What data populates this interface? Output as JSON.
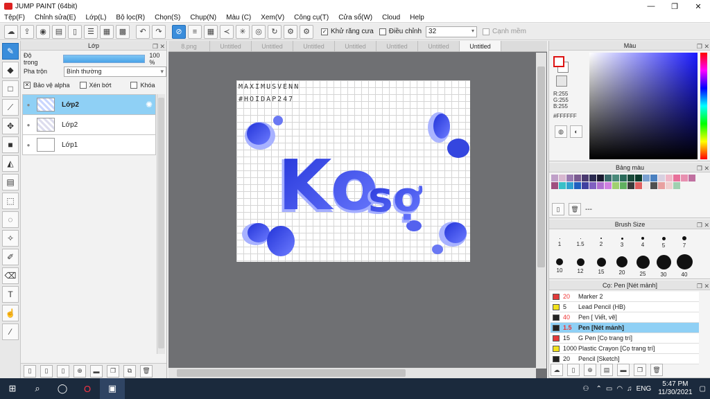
{
  "window": {
    "title": "JUMP PAINT (64bit)"
  },
  "menu": [
    "Tệp(F)",
    "Chỉnh sửa(E)",
    "Lớp(L)",
    "Bộ lọc(R)",
    "Chọn(S)",
    "Chụp(N)",
    "Màu (C)",
    "Xem(V)",
    "Công cụ(T)",
    "Cửa sổ(W)",
    "Cloud",
    "Help"
  ],
  "toolbar": {
    "antialias_label": "Khử răng cưa",
    "adjust_label": "Điều chỉnh",
    "adjust_value": "32",
    "smooth_label": "Cạnh mềm"
  },
  "layer_panel": {
    "title": "Lớp",
    "opacity_label": "Độ trong",
    "opacity_value": "100 %",
    "blend_label": "Pha trộn",
    "blend_value": "Bình thường",
    "protect_alpha": "Bảo vệ alpha",
    "clipping": "Xén bớt",
    "lock": "Khóa",
    "layers": [
      {
        "name": "Lớp2",
        "selected": true
      },
      {
        "name": "Lớp2",
        "selected": false
      },
      {
        "name": "Lớp1",
        "selected": false
      }
    ]
  },
  "doc_tabs": [
    "8.png",
    "Untitled",
    "Untitled",
    "Untitled",
    "Untitled",
    "Untitled",
    "Untitled",
    "Untitled"
  ],
  "canvas": {
    "watermark_line1": "MAXIMUSVENN",
    "watermark_line2": "#HOIDAP247",
    "art_text": "Ko sợ"
  },
  "color_panel": {
    "title": "Màu",
    "r": "R:255",
    "g": "G:255",
    "b": "B:255",
    "hex": "#FFFFFF"
  },
  "palette_panel": {
    "title": "Bảng màu",
    "footer_text": "---"
  },
  "brush_size_panel": {
    "title": "Brush Size",
    "sizes": [
      "1",
      "1.5",
      "2",
      "3",
      "4",
      "5",
      "7",
      "10",
      "12",
      "15",
      "20",
      "25",
      "30",
      "40"
    ]
  },
  "brush_list_panel": {
    "title": "Cọ: Pen [Nét mảnh]",
    "items": [
      {
        "size": "20",
        "name": "Marker 2",
        "color": "#e33b3b",
        "red": true
      },
      {
        "size": "5",
        "name": "Lead Pencil (HB)",
        "color": "#f2e21c",
        "red": false
      },
      {
        "size": "40",
        "name": "Pen [ Viết, vẽ]",
        "color": "#222222",
        "red": true
      },
      {
        "size": "1.5",
        "name": "Pen [Nét mảnh]",
        "color": "#222222",
        "red": true
      },
      {
        "size": "15",
        "name": "G Pen [Cọ trang trí]",
        "color": "#e33b3b",
        "red": false
      },
      {
        "size": "1000",
        "name": "Plastic Crayon [Cọ trang trí]",
        "color": "#f2e21c",
        "red": false
      },
      {
        "size": "20",
        "name": "Pencil [Sketch]",
        "color": "#222222",
        "red": false
      }
    ]
  },
  "taskbar": {
    "language": "ENG",
    "time": "5:47 PM",
    "date": "11/30/2021"
  },
  "colors": {
    "accent": "#3a8ddb",
    "selected_row": "#8fd0f5",
    "art_blue": "#3b4fe0",
    "art_light": "#9aa8ff"
  }
}
